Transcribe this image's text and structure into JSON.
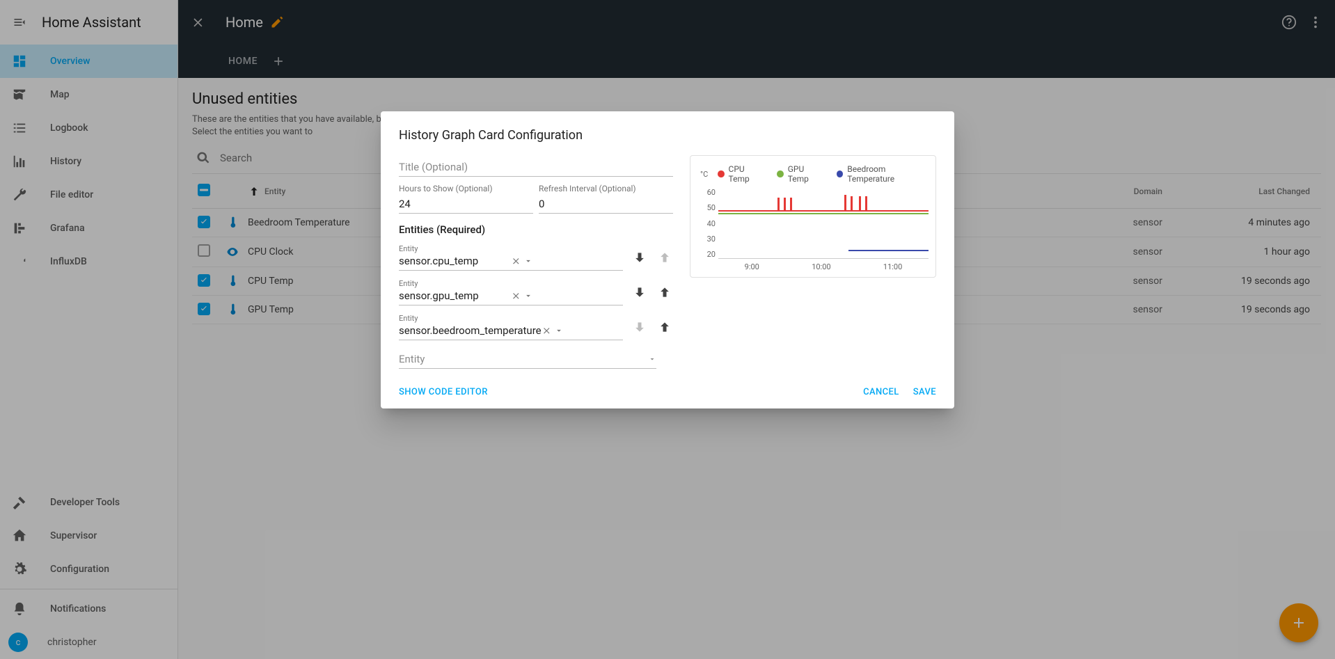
{
  "app": {
    "title": "Home Assistant"
  },
  "sidebar": {
    "items": [
      {
        "label": "Overview"
      },
      {
        "label": "Map"
      },
      {
        "label": "Logbook"
      },
      {
        "label": "History"
      },
      {
        "label": "File editor"
      },
      {
        "label": "Grafana"
      },
      {
        "label": "InfluxDB"
      }
    ],
    "bottom": [
      {
        "label": "Developer Tools"
      },
      {
        "label": "Supervisor"
      },
      {
        "label": "Configuration"
      }
    ],
    "notifications_label": "Notifications",
    "user": {
      "initial": "c",
      "name": "christopher"
    }
  },
  "header": {
    "title": "Home",
    "tabs": [
      {
        "label": "HOME"
      }
    ]
  },
  "page": {
    "heading": "Unused entities",
    "description1": "These are the entities that you have available, but are not in your Lovelace UI yet.",
    "description2": "Select the entities you want to",
    "search_placeholder": "Search",
    "columns": {
      "entity": "Entity",
      "domain": "Domain",
      "last_changed": "Last Changed"
    },
    "rows": [
      {
        "name": "Beedroom Temperature",
        "domain": "sensor",
        "last": "4 minutes ago",
        "checked": true,
        "icon": "thermometer"
      },
      {
        "name": "CPU Clock",
        "domain": "sensor",
        "last": "1 hour ago",
        "checked": false,
        "icon": "eye"
      },
      {
        "name": "CPU Temp",
        "domain": "sensor",
        "last": "19 seconds ago",
        "checked": true,
        "icon": "thermometer"
      },
      {
        "name": "GPU Temp",
        "domain": "sensor",
        "last": "19 seconds ago",
        "checked": true,
        "icon": "thermometer"
      }
    ]
  },
  "dialog": {
    "title": "History Graph Card Configuration",
    "title_label": "Title (Optional)",
    "hours_label": "Hours to Show (Optional)",
    "hours_value": "24",
    "refresh_label": "Refresh Interval (Optional)",
    "refresh_value": "0",
    "entities_label": "Entities (Required)",
    "entity_field_label": "Entity",
    "entities": [
      {
        "value": "sensor.cpu_temp",
        "up": false,
        "down": true
      },
      {
        "value": "sensor.gpu_temp",
        "up": true,
        "down": true
      },
      {
        "value": "sensor.beedroom_temperature",
        "up": true,
        "down": false
      }
    ],
    "add_entity_placeholder": "Entity",
    "show_code_editor": "SHOW CODE EDITOR",
    "cancel": "CANCEL",
    "save": "SAVE"
  },
  "chart_data": {
    "type": "line",
    "unit": "°C",
    "ylim": [
      20,
      60
    ],
    "yticks": [
      60,
      50,
      40,
      30,
      20
    ],
    "x_labels": [
      "9:00",
      "10:00",
      "11:00"
    ],
    "series": [
      {
        "name": "CPU Temp",
        "color": "#E53935",
        "baseline": 47,
        "spikes_to": 54
      },
      {
        "name": "GPU Temp",
        "color": "#7CB342",
        "baseline": 46
      },
      {
        "name": "Beedroom Temperature",
        "color": "#3949AB",
        "baseline": 23,
        "starts_at_fraction": 0.62
      }
    ]
  }
}
